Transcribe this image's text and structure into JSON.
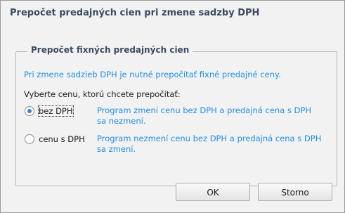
{
  "window": {
    "title": "Prepočet predajných cien pri zmene sadzby DPH"
  },
  "group": {
    "title": "Prepočet fixných predajných cien",
    "info_text": "Pri zmene sadzieb DPH je nutné prepočítať fixné predajné ceny.",
    "prompt_text": "Vyberte cenu, ktorú chcete prepočítať:",
    "options": [
      {
        "label": "bez DPH",
        "description": "Program zmení cenu bez DPH a predajná cena s DPH sa nezmení.",
        "selected": true
      },
      {
        "label": "cenu s DPH",
        "description": "Program nezmení cenu bez DPH a predajná cena s DPH sa zmení.",
        "selected": false
      }
    ]
  },
  "buttons": {
    "ok_label": "OK",
    "cancel_label": "Storno"
  },
  "colors": {
    "title_text": "#3b4a62",
    "info_text": "#1f8ee8",
    "background": "#f2f2f2"
  }
}
